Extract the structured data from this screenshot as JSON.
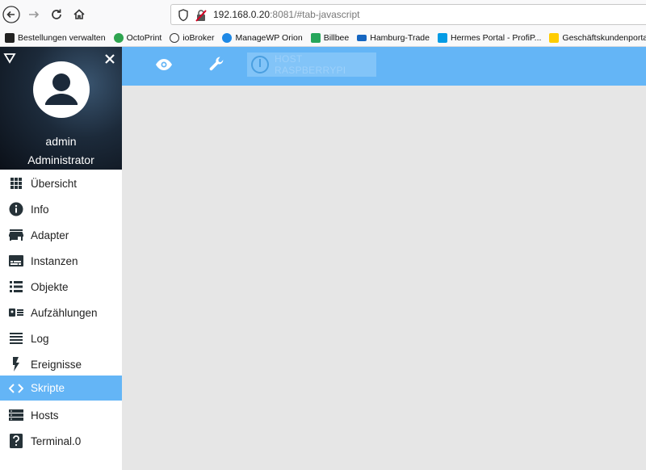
{
  "browser": {
    "url_host": "192.168.0.20",
    "url_rest": ":8081/#tab-javascript"
  },
  "bookmarks": [
    {
      "label": "Bestellungen verwalten",
      "color": "#222222"
    },
    {
      "label": "OctoPrint",
      "color": "#2ea44f"
    },
    {
      "label": "ioBroker",
      "color": "#333333"
    },
    {
      "label": "ManageWP Orion",
      "color": "#1e88e5"
    },
    {
      "label": "Billbee",
      "color": "#26a65b"
    },
    {
      "label": "Hamburg-Trade",
      "color": "#1565c0"
    },
    {
      "label": "Hermes Portal - ProfiP...",
      "color": "#039be5"
    },
    {
      "label": "Geschäftskundenporta",
      "color": "#ffcc00"
    }
  ],
  "user": {
    "name": "admin",
    "role": "Administrator"
  },
  "sidebar": {
    "items": [
      {
        "label": "Übersicht",
        "icon": "apps-icon"
      },
      {
        "label": "Info",
        "icon": "info-icon"
      },
      {
        "label": "Adapter",
        "icon": "store-icon"
      },
      {
        "label": "Instanzen",
        "icon": "subtitles-icon"
      },
      {
        "label": "Objekte",
        "icon": "list-icon"
      },
      {
        "label": "Aufzählungen",
        "icon": "enum-icon"
      },
      {
        "label": "Log",
        "icon": "log-icon"
      },
      {
        "label": "Ereignisse",
        "icon": "flash-icon"
      },
      {
        "label": "Skripte",
        "icon": "code-icon",
        "active": true
      },
      {
        "label": "Hosts",
        "icon": "storage-icon"
      },
      {
        "label": "Terminal.0",
        "icon": "help-icon"
      }
    ]
  },
  "toolbar": {
    "host_label": "HOST RASPBERRYPI"
  },
  "colors": {
    "accent": "#64b5f6",
    "content_bg": "#e6e6e6"
  }
}
